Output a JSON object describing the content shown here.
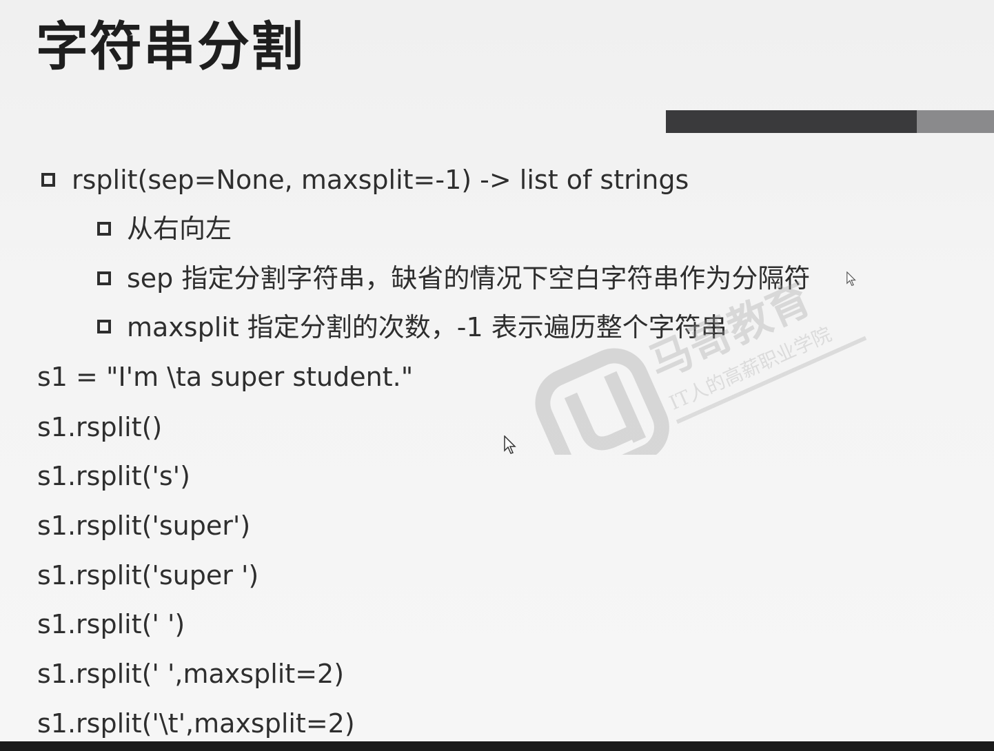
{
  "slide": {
    "title": "字符串分割",
    "bullets": [
      {
        "level": 1,
        "text": "rsplit(sep=None, maxsplit=-1) -> list of strings"
      },
      {
        "level": 2,
        "text": "从右向左"
      },
      {
        "level": 2,
        "text": "sep 指定分割字符串，缺省的情况下空白字符串作为分隔符"
      },
      {
        "level": 2,
        "text": "maxsplit 指定分割的次数，-1 表示遍历整个字符串"
      }
    ],
    "code_lines": [
      "s1 = \"I'm \\ta  super student.\"",
      "s1.rsplit()",
      "s1.rsplit('s')",
      "s1.rsplit('super')",
      "s1.rsplit('super ')",
      "s1.rsplit(' ')",
      "s1.rsplit(' ',maxsplit=2)",
      "s1.rsplit('\\t',maxsplit=2)"
    ]
  },
  "watermark": {
    "brand": "马哥教育",
    "tagline": "IT人的高薪职业学院"
  },
  "colors": {
    "accent_dark": "#3a3a3c",
    "accent_light": "#8a8a8c",
    "text": "#2e2e2e",
    "background": "#f2f2f2"
  }
}
